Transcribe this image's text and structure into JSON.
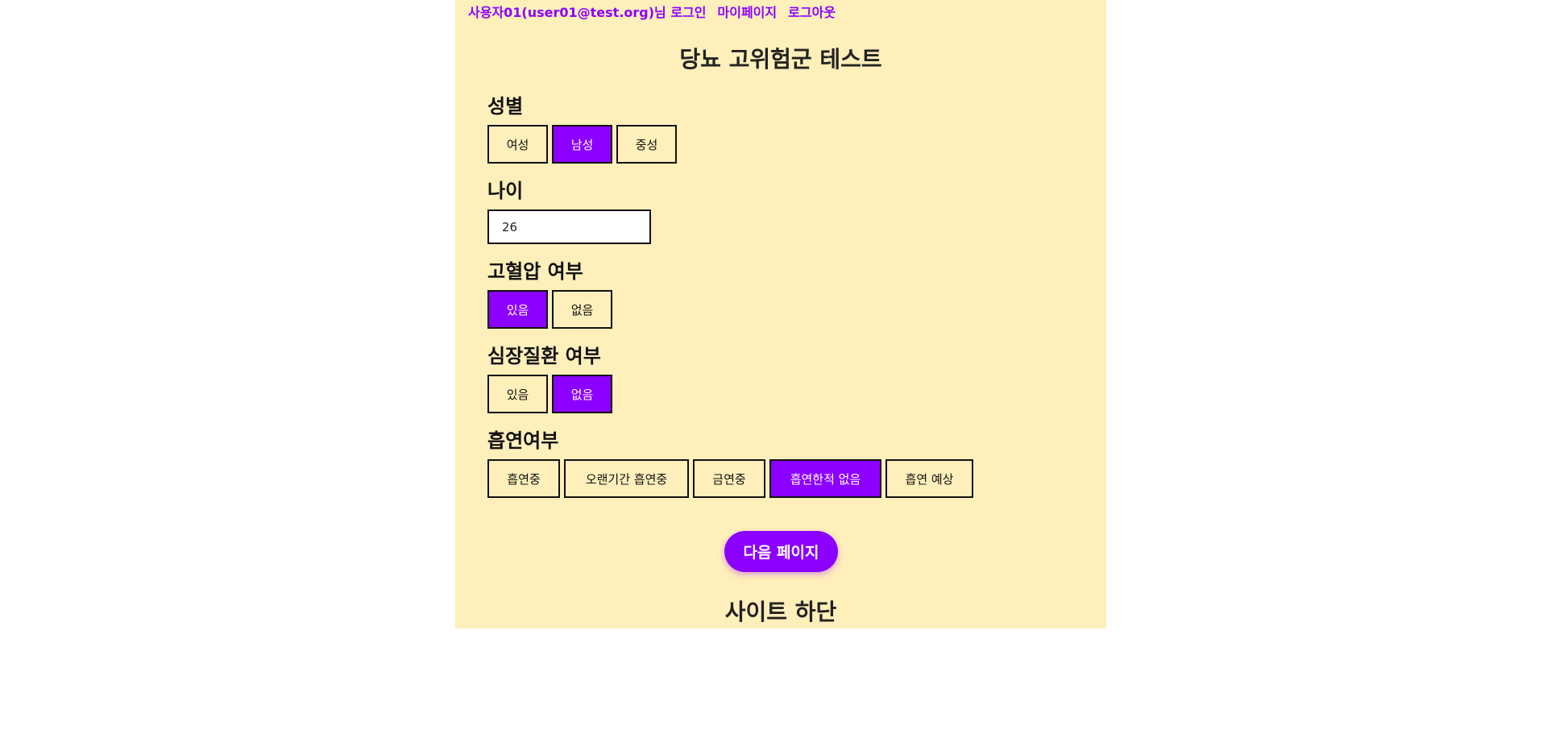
{
  "header": {
    "user_text": "사용자01(user01@test.org)님 로그인",
    "mypage_label": "마이페이지",
    "logout_label": "로그아웃"
  },
  "title": "당뇨 고위험군 테스트",
  "gender": {
    "label": "성별",
    "options": [
      "여성",
      "남성",
      "중성"
    ],
    "selected": 1
  },
  "age": {
    "label": "나이",
    "value": "26"
  },
  "hypertension": {
    "label": "고혈압 여부",
    "options": [
      "있음",
      "없음"
    ],
    "selected": 0
  },
  "heart_disease": {
    "label": "심장질환 여부",
    "options": [
      "있음",
      "없음"
    ],
    "selected": 1
  },
  "smoking": {
    "label": "흡연여부",
    "options": [
      "흡연중",
      "오랜기간 흡연중",
      "금연중",
      "흡연한적 없음",
      "흡연 예상"
    ],
    "selected": 3
  },
  "next_button_label": "다음 페이지",
  "footer": "사이트 하단",
  "colors": {
    "accent": "#8c00ff",
    "background": "#ffefba",
    "text": "#111111"
  }
}
